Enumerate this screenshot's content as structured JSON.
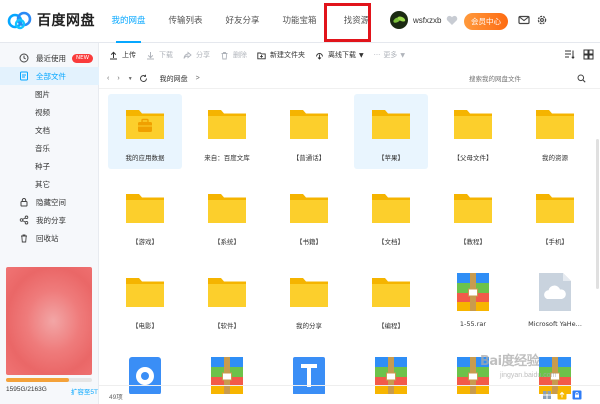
{
  "app": {
    "title": "百度网盘",
    "brand_color": "#06a7ff",
    "accent_color": "#fe6b12"
  },
  "nav": {
    "tabs": [
      {
        "label": "我的网盘",
        "active": true
      },
      {
        "label": "传输列表",
        "active": false
      },
      {
        "label": "好友分享",
        "active": false
      },
      {
        "label": "功能宝箱",
        "active": false
      },
      {
        "label": "找资源",
        "active": false,
        "highlighted": true
      }
    ]
  },
  "user": {
    "name": "wsfxzxb",
    "member_label": "会员中心"
  },
  "sidebar": {
    "items": [
      {
        "label": "最近使用",
        "icon": "clock-icon",
        "badge": "NEW"
      },
      {
        "label": "全部文件",
        "icon": "file-icon",
        "active": true
      },
      {
        "label": "图片",
        "sub": true
      },
      {
        "label": "视频",
        "sub": true
      },
      {
        "label": "文档",
        "sub": true
      },
      {
        "label": "音乐",
        "sub": true
      },
      {
        "label": "种子",
        "sub": true
      },
      {
        "label": "其它",
        "sub": true
      },
      {
        "label": "隐藏空间",
        "icon": "lock-icon"
      },
      {
        "label": "我的分享",
        "icon": "share-icon"
      },
      {
        "label": "回收站",
        "icon": "trash-icon"
      }
    ],
    "storage": {
      "text": "1595G/2163G",
      "expand_label": "扩容至5T",
      "used_fraction": 0.737
    }
  },
  "toolbar": {
    "upload": "上传",
    "download": "下载",
    "share": "分享",
    "delete": "删除",
    "new_folder": "新建文件夹",
    "offline_download": "离线下载",
    "more": "更多"
  },
  "path": {
    "crumb": "我的网盘",
    "separator": ">",
    "search_placeholder": "搜索我的网盘文件"
  },
  "files": [
    {
      "name": "我的应用数据",
      "type": "app-folder",
      "selected": true
    },
    {
      "name": "来自：百度文库",
      "type": "folder"
    },
    {
      "name": "【普通话】",
      "type": "folder"
    },
    {
      "name": "【苹果】",
      "type": "folder",
      "selected": true
    },
    {
      "name": "【父母文件】",
      "type": "folder"
    },
    {
      "name": "我的资源",
      "type": "folder"
    },
    {
      "name": "【游戏】",
      "type": "folder"
    },
    {
      "name": "【系统】",
      "type": "folder"
    },
    {
      "name": "【书籍】",
      "type": "folder"
    },
    {
      "name": "【文档】",
      "type": "folder"
    },
    {
      "name": "【教程】",
      "type": "folder"
    },
    {
      "name": "【手机】",
      "type": "folder"
    },
    {
      "name": "【电影】",
      "type": "folder"
    },
    {
      "name": "【软件】",
      "type": "folder"
    },
    {
      "name": "我的分享",
      "type": "folder"
    },
    {
      "name": "【编程】",
      "type": "folder"
    },
    {
      "name": "1-55.rar",
      "type": "rar"
    },
    {
      "name": "Microsoft YaHe...",
      "type": "cloud-file"
    },
    {
      "name": "",
      "type": "disk"
    },
    {
      "name": "",
      "type": "rar"
    },
    {
      "name": "",
      "type": "text-doc"
    },
    {
      "name": "",
      "type": "rar"
    },
    {
      "name": "",
      "type": "rar"
    },
    {
      "name": "",
      "type": "rar"
    }
  ],
  "footer": {
    "count": "49项"
  },
  "watermark": {
    "line1": "Bai度经验",
    "line2": "jingyan.baidu.com"
  }
}
